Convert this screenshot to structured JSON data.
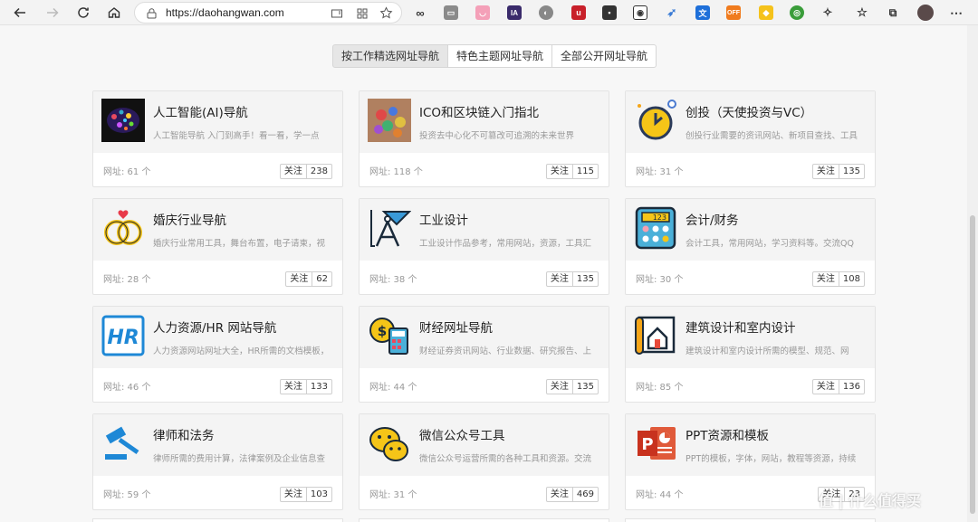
{
  "browser": {
    "url": "https://daohangwan.com"
  },
  "tabs": [
    {
      "label": "按工作精选网址导航",
      "active": true
    },
    {
      "label": "特色主题网址导航",
      "active": false
    },
    {
      "label": "全部公开网址导航",
      "active": false
    }
  ],
  "follow_label": "关注",
  "cards": [
    {
      "title": "人工智能(AI)导航",
      "desc": "人工智能导航 入门到高手！看一看，学一点",
      "count": "网址: 61 个",
      "follows": "238",
      "icon": "ai-brain-icon"
    },
    {
      "title": "ICO和区块链入门指北",
      "desc": "投资去中心化不可篡改可追溯的未来世界",
      "count": "网址: 118 个",
      "follows": "115",
      "icon": "colored-stones-icon"
    },
    {
      "title": "创投（天使投资与VC）",
      "desc": "创投行业需要的资讯网站、新项目查找、工具",
      "count": "网址: 31 个",
      "follows": "135",
      "icon": "clock-icon"
    },
    {
      "title": "婚庆行业导航",
      "desc": "婚庆行业常用工具，舞台布置，电子请柬，视",
      "count": "网址: 28 个",
      "follows": "62",
      "icon": "wedding-rings-icon"
    },
    {
      "title": "工业设计",
      "desc": "工业设计作品参考，常用网站，资源，工具汇",
      "count": "网址: 38 个",
      "follows": "135",
      "icon": "drafting-compass-icon"
    },
    {
      "title": "会计/财务",
      "desc": "会计工具，常用网站，学习资料等。交流QQ",
      "count": "网址: 30 个",
      "follows": "108",
      "icon": "calculator-icon"
    },
    {
      "title": "人力资源/HR 网站导航",
      "desc": "人力资源网站网址大全，HR所需的文档模板，",
      "count": "网址: 46 个",
      "follows": "133",
      "icon": "hr-icon"
    },
    {
      "title": "财经网址导航",
      "desc": "财经证券资讯网站、行业数据、研究报告、上",
      "count": "网址: 44 个",
      "follows": "135",
      "icon": "finance-calculator-icon"
    },
    {
      "title": "建筑设计和室内设计",
      "desc": "建筑设计和室内设计所需的模型、规范、网",
      "count": "网址: 85 个",
      "follows": "136",
      "icon": "blueprint-house-icon"
    },
    {
      "title": "律师和法务",
      "desc": "律师所需的费用计算，法律案例及企业信息查",
      "count": "网址: 59 个",
      "follows": "103",
      "icon": "gavel-icon"
    },
    {
      "title": "微信公众号工具",
      "desc": "微信公众号运营所需的各种工具和资源。交流",
      "count": "网址: 31 个",
      "follows": "469",
      "icon": "wechat-icon"
    },
    {
      "title": "PPT资源和模板",
      "desc": "PPT的模板，字体，网站，教程等资源，持续",
      "count": "网址: 44 个",
      "follows": "23",
      "icon": "powerpoint-icon"
    }
  ],
  "watermark": "值 | 什么值得买"
}
